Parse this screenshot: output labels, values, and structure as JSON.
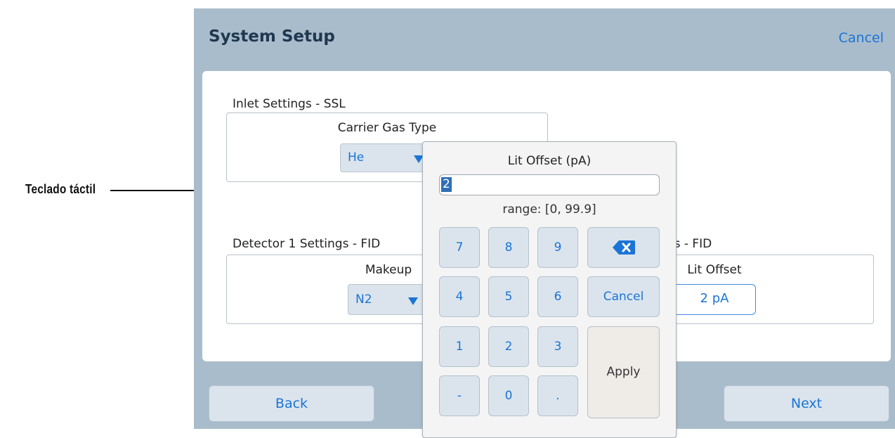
{
  "callout": {
    "label": "Teclado táctil"
  },
  "header": {
    "title": "System Setup",
    "cancel": "Cancel"
  },
  "inlet": {
    "section_title": "Inlet Settings - SSL",
    "carrier_label": "Carrier Gas Type",
    "carrier_value": "He"
  },
  "detector1": {
    "section_title": "Detector 1 Settings - FID",
    "makeup_label": "Makeup",
    "makeup_value": "N2"
  },
  "detector2": {
    "section_title_visible": "ngs - FID",
    "lit_label": "Lit Offset",
    "lit_value": "2 pA"
  },
  "footer": {
    "back": "Back",
    "next": "Next"
  },
  "keypad": {
    "title": "Lit Offset (pA)",
    "input_value": "2",
    "range": "range: [0, 99.9]",
    "keys": {
      "k7": "7",
      "k8": "8",
      "k9": "9",
      "k4": "4",
      "k5": "5",
      "k6": "6",
      "k1": "1",
      "k2": "2",
      "k3": "3",
      "minus": "-",
      "k0": "0",
      "dot": ".",
      "cancel": "Cancel",
      "apply": "Apply"
    },
    "backspace_icon": "backspace-icon"
  },
  "colors": {
    "accent": "#1b74d6",
    "background": "#a9bccb",
    "title": "#1f3850"
  }
}
